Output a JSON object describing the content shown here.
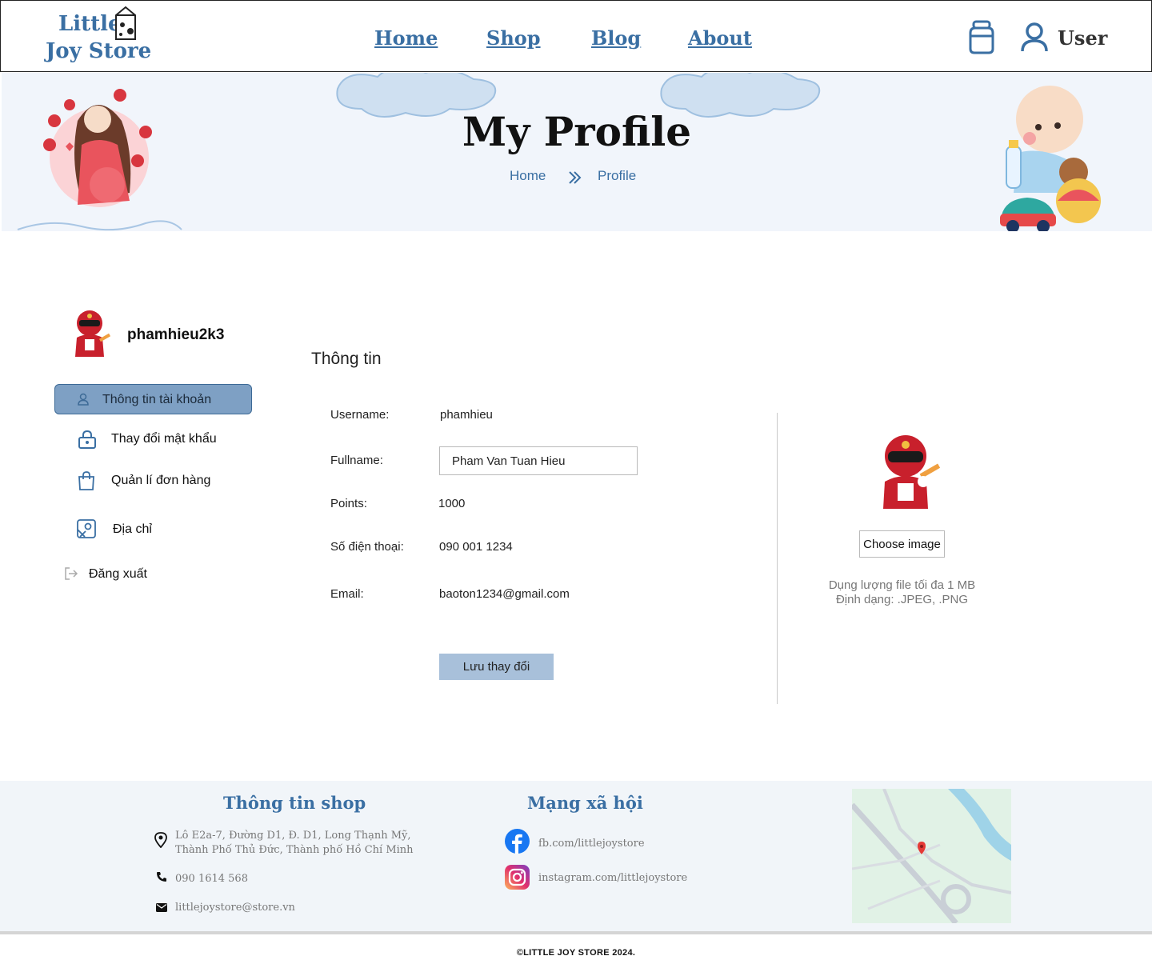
{
  "header": {
    "logo_line1": "Little",
    "logo_line2": "Joy Store",
    "nav": [
      "Home",
      "Shop",
      "Blog",
      "About"
    ],
    "user_label": "User"
  },
  "banner": {
    "title": "My Profile",
    "breadcrumb": [
      "Home",
      "Profile"
    ]
  },
  "sidebar": {
    "username": "phamhieu2k3",
    "items": [
      {
        "label": "Thông tin tài khoản",
        "icon": "user-icon"
      },
      {
        "label": "Thay đổi mật khẩu",
        "icon": "lock-icon"
      },
      {
        "label": "Quản lí đơn hàng",
        "icon": "shopping-bag-icon"
      },
      {
        "label": "Địa chỉ",
        "icon": "map-icon"
      },
      {
        "label": "Đăng xuất",
        "icon": "logout-icon"
      }
    ]
  },
  "profile": {
    "section_title": "Thông tin",
    "fields": {
      "username_label": "Username:",
      "username_value": "phamhieu",
      "fullname_label": "Fullname:",
      "fullname_value": "Pham Van Tuan Hieu",
      "points_label": "Points:",
      "points_value": "1000",
      "phone_label": "Số điện thoại:",
      "phone_value": "090 001 1234",
      "email_label": "Email:",
      "email_value": "baoton1234@gmail.com"
    },
    "save_label": "Lưu thay đổi",
    "choose_image_label": "Choose image",
    "hint_size": "Dụng lượng file tối đa 1 MB",
    "hint_format": "Định dạng: .JPEG, .PNG"
  },
  "footer": {
    "shop_heading": "Thông tin shop",
    "address_line1": "Lô E2a-7, Đường D1, Đ. D1, Long Thạnh Mỹ,",
    "address_line2": "Thành Phố Thủ Đức, Thành phố Hồ Chí Minh",
    "phone": "090 1614 568",
    "email": "littlejoystore@store.vn",
    "social_heading": "Mạng xã hội",
    "facebook": "fb.com/littlejoystore",
    "instagram": "instagram.com/littlejoystore",
    "copyright": "©LITTLE JOY STORE 2024."
  },
  "colors": {
    "brand": "#3a6fa3",
    "active_item": "#7ea0c4",
    "save_button": "#a8c0da",
    "banner_bg": "#f1f5fb",
    "footer_bg": "#f1f5f9"
  }
}
